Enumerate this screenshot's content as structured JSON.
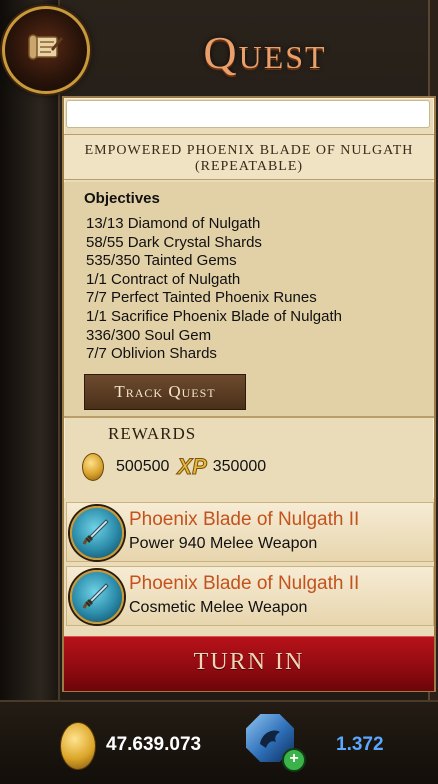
{
  "header": {
    "title": "Quest"
  },
  "quest": {
    "name_line1": "EMPOWERED PHOENIX BLADE OF NULGATH",
    "name_line2": "(REPEATABLE)",
    "objectives_title": "Objectives",
    "objectives": [
      "13/13 Diamond of Nulgath",
      "58/55 Dark Crystal Shards",
      "535/350 Tainted Gems",
      "1/1 Contract of Nulgath",
      "7/7 Perfect Tainted Phoenix Runes",
      "1/1 Sacrifice Phoenix Blade of Nulgath",
      "336/300 Soul Gem",
      "7/7 Oblivion Shards"
    ],
    "track_button": "Track Quest"
  },
  "rewards": {
    "label": "REWARDS",
    "gold": "500500",
    "xp_icon": "XP",
    "xp": "350000",
    "items": [
      {
        "name": "Phoenix Blade of Nulgath II",
        "desc": "Power 940 Melee Weapon",
        "icon": "sword-icon"
      },
      {
        "name": "Phoenix Blade of Nulgath II",
        "desc": "Cosmetic Melee Weapon",
        "icon": "sword-icon"
      }
    ]
  },
  "turn_in_button": "TURN IN",
  "currency": {
    "gold": "47.639.073",
    "acs": "1.372",
    "acs_add": "+"
  },
  "colors": {
    "title": "#e9a06a",
    "item_name": "#c4521e",
    "turn_in": "#b8121a",
    "acs_text": "#5aa8ff"
  }
}
